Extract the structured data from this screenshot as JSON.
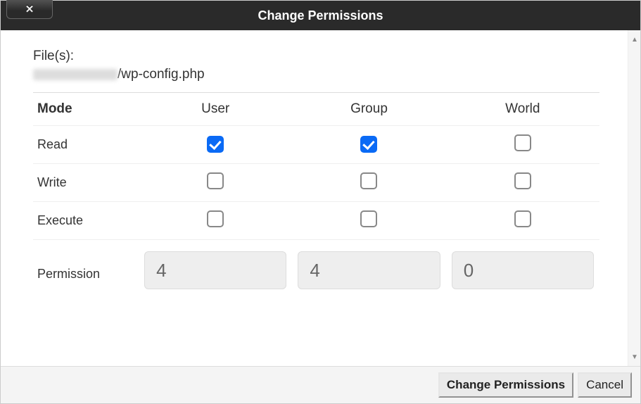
{
  "dialog": {
    "title": "Change Permissions",
    "files_label": "File(s):",
    "file_path_suffix": "/wp-config.php"
  },
  "columns": {
    "mode": "Mode",
    "user": "User",
    "group": "Group",
    "world": "World"
  },
  "rows": {
    "read": {
      "label": "Read",
      "user": true,
      "group": true,
      "world": false
    },
    "write": {
      "label": "Write",
      "user": false,
      "group": false,
      "world": false
    },
    "execute": {
      "label": "Execute",
      "user": false,
      "group": false,
      "world": false
    }
  },
  "permission": {
    "label": "Permission",
    "user": "4",
    "group": "4",
    "world": "0"
  },
  "buttons": {
    "confirm": "Change Permissions",
    "cancel": "Cancel"
  }
}
